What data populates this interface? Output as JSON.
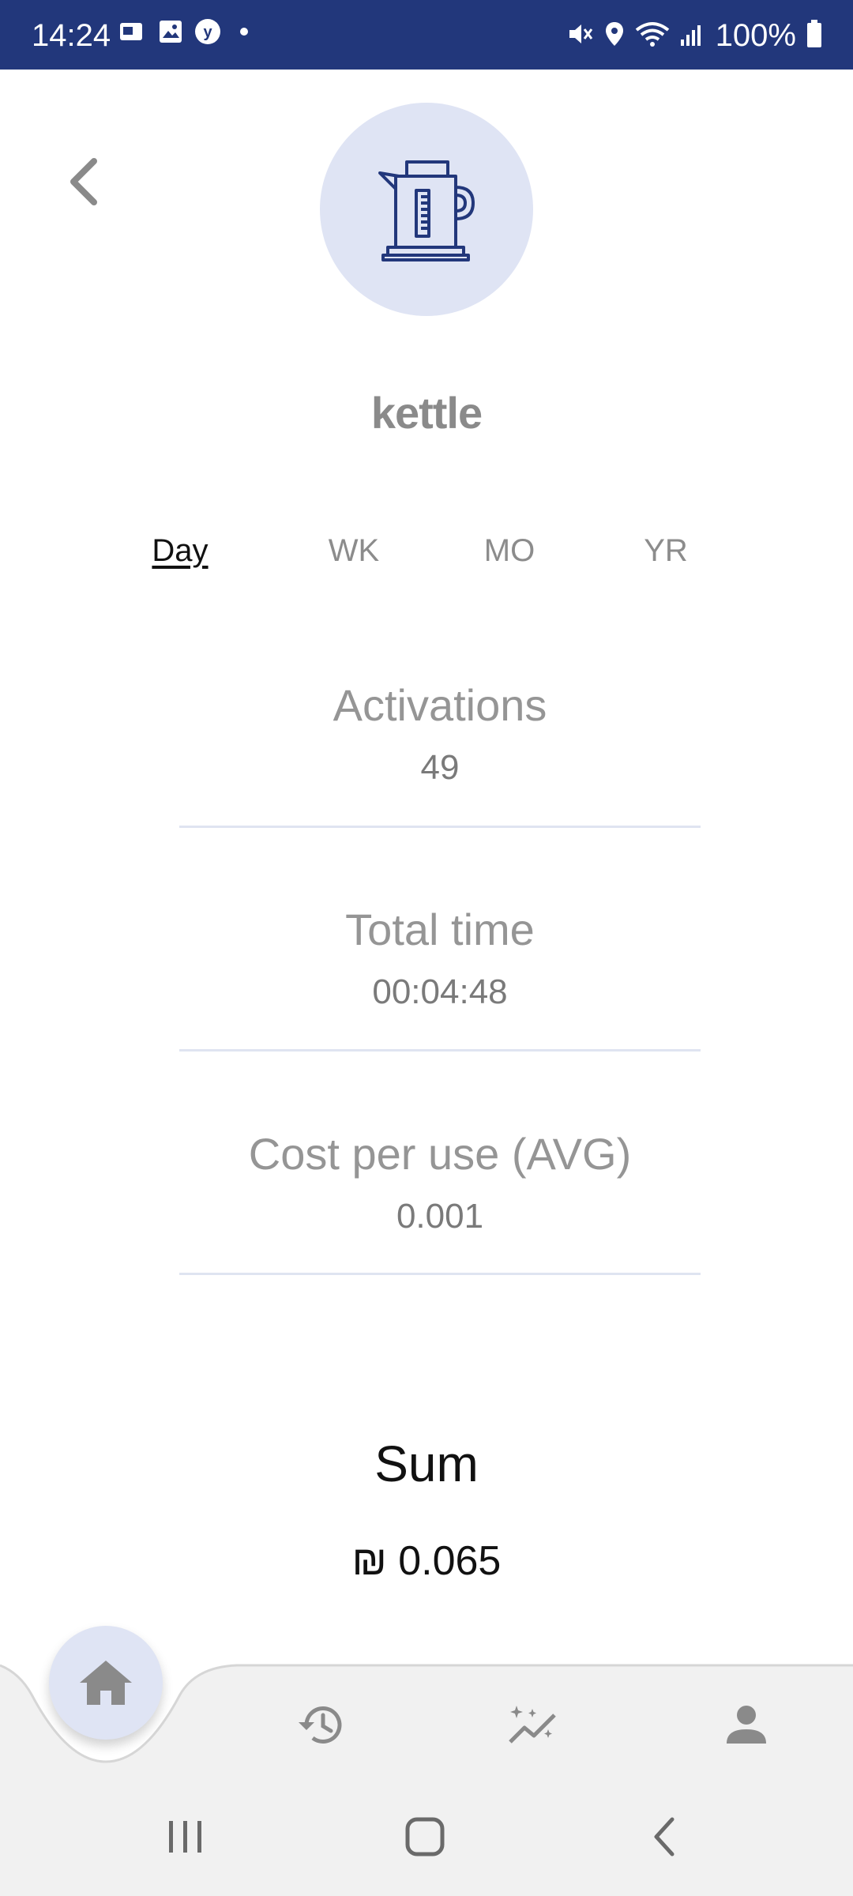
{
  "status_bar": {
    "time": "14:24",
    "battery": "100%",
    "background": "#22377b",
    "icons": [
      "notification-icon",
      "gallery-icon",
      "y-app-icon",
      "dot-icon",
      "mute-icon",
      "location-icon",
      "wifi-icon",
      "signal-icon",
      "battery-icon"
    ]
  },
  "device": {
    "name": "kettle",
    "icon": "kettle-icon",
    "accent": "#22377b",
    "avatar_bg": "#dfe4f4"
  },
  "periods": {
    "items": [
      "Day",
      "WK",
      "MO",
      "YR"
    ],
    "selected": "Day"
  },
  "stats": [
    {
      "label": "Activations",
      "value": "49"
    },
    {
      "label": "Total time",
      "value": "00:04:48"
    },
    {
      "label": "Cost per use (AVG)",
      "value": "0.001"
    }
  ],
  "sum": {
    "label": "Sum",
    "value": "₪ 0.065"
  },
  "bottom_nav": {
    "items": [
      "home-icon",
      "history-icon",
      "insights-icon",
      "profile-icon"
    ]
  }
}
